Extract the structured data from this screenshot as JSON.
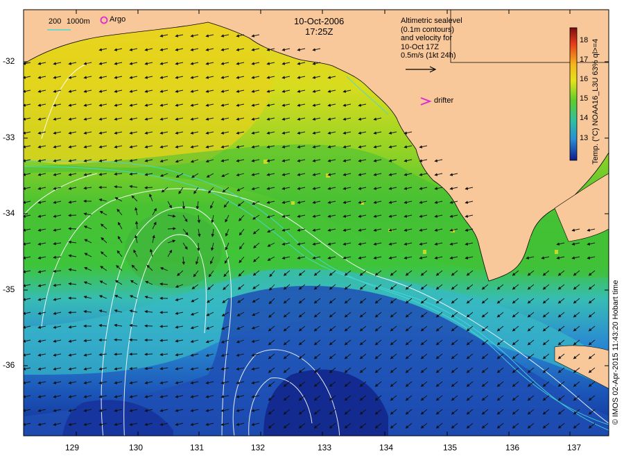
{
  "header": {
    "date": "10-Oct-2006",
    "time": "17:25Z"
  },
  "legend": {
    "depth_200": "200",
    "depth_1000": "1000m",
    "argo_label": "Argo",
    "drifter_label": "drifter",
    "altimetry_lines": [
      "Altimetric sealevel",
      "(0.1m contours)",
      "and velocity for",
      "10-Oct 17Z",
      "0.5m/s (1kt 24h)"
    ]
  },
  "colorbar": {
    "label": "Temp. (°C) NOAA16_L3U 63% ql>=4",
    "ticks": [
      "18",
      "17",
      "16",
      "15",
      "14",
      "13"
    ]
  },
  "credit": "© IMOS 02-Apr-2015 11:43:20 Hobart time",
  "axes": {
    "y_labels": [
      "-32",
      "-33",
      "-34",
      "-35",
      "-36"
    ],
    "x_labels": [
      "129",
      "130",
      "131",
      "132",
      "133",
      "134",
      "135",
      "136",
      "137"
    ]
  },
  "colors": {
    "land": "#f9c89a",
    "sst_warm": "#e8d21e",
    "sst_mid": "#49c232",
    "sst_cool": "#35b8c8",
    "sst_cold": "#1a3fa8",
    "contour": "#ffffff",
    "bathy": "#44d7d7",
    "argo": "#e02ad0"
  }
}
